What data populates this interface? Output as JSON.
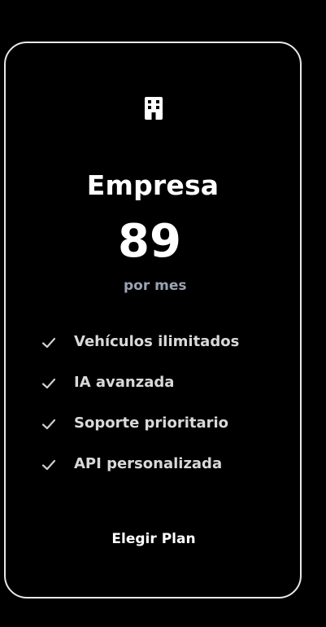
{
  "plan": {
    "icon": "building-icon",
    "name": "Empresa",
    "price": "89",
    "period": "por mes",
    "features": [
      {
        "icon": "check-icon",
        "label": "Vehículos ilimitados"
      },
      {
        "icon": "check-icon",
        "label": "IA avanzada"
      },
      {
        "icon": "check-icon",
        "label": "Soporte prioritario"
      },
      {
        "icon": "check-icon",
        "label": "API personalizada"
      }
    ],
    "cta_label": "Elegir Plan"
  },
  "colors": {
    "background": "#000000",
    "card_border": "#e8e8e8",
    "text_primary": "#ffffff",
    "text_muted": "#9aa3b2",
    "feature_text": "#d9d9d9"
  }
}
